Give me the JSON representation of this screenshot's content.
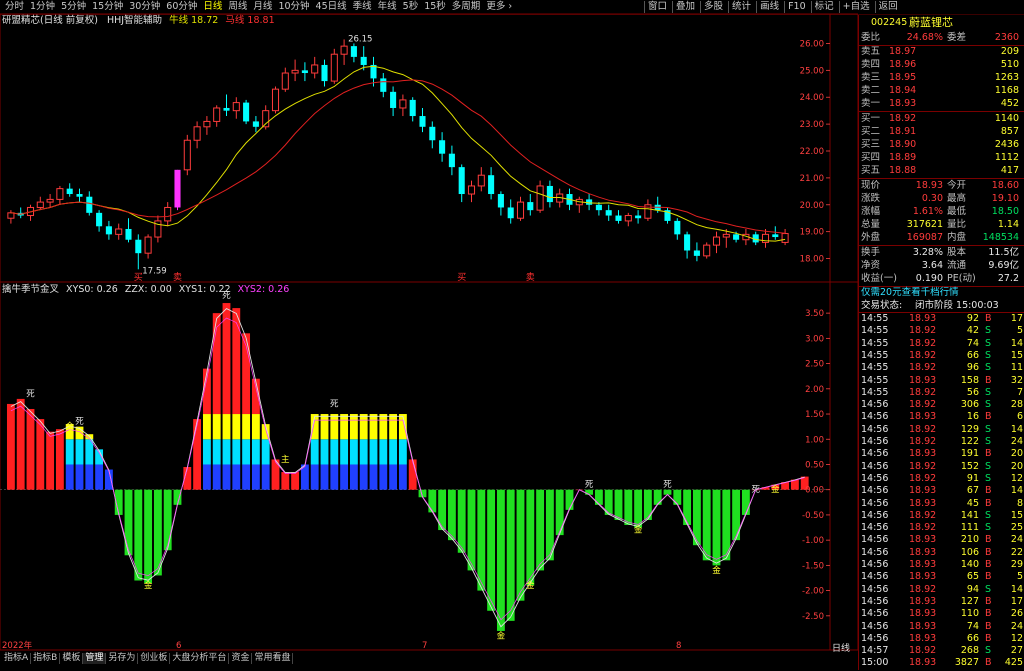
{
  "topbar": {
    "periods": [
      "分时",
      "1分钟",
      "5分钟",
      "15分钟",
      "30分钟",
      "60分钟",
      "日线",
      "周线",
      "月线",
      "10分钟",
      "45日线",
      "季线",
      "年线",
      "5秒",
      "15秒",
      "多周期",
      "更多 ›"
    ],
    "active_period": "日线",
    "tools": [
      "窗口",
      "叠加",
      "多股",
      "统计",
      "画线",
      "F10",
      "标记",
      "+自选",
      "返回"
    ]
  },
  "main_header": {
    "name": "研盟精芯(日线 前复权)",
    "indicator": "HHJ智能辅助",
    "bull_label": "牛线",
    "bull_value": "18.72",
    "horse_label": "马线",
    "horse_value": "18.81"
  },
  "sub_header": {
    "name": "擒牛季节金叉",
    "items": [
      "XYS0: 0.26",
      "ZZX: 0.00",
      "XYS1: 0.22",
      "XYS2: 0.26"
    ]
  },
  "price_axis": [
    "26.00",
    "25.00",
    "24.00",
    "23.00",
    "22.00",
    "21.00",
    "20.00",
    "19.00",
    "18.00"
  ],
  "sub_axis": [
    "3.50",
    "3.00",
    "2.50",
    "2.00",
    "1.50",
    "1.00",
    "0.50",
    "0.00",
    "-0.50",
    "-1.00",
    "-1.50",
    "-2.00",
    "-2.50"
  ],
  "annotations": {
    "high": "26.15",
    "low": "17.59",
    "buy": "买",
    "sell": "卖",
    "signal_death": "死",
    "signal_gold": "金",
    "signal_main": "主"
  },
  "date_labels": [
    "2022年",
    "6",
    "7",
    "8"
  ],
  "bottom_tabs": [
    "指标A",
    "指标B",
    "模板",
    "管理",
    "另存为",
    "创业板",
    "大盘分析平台",
    "资金",
    "常用看盘"
  ],
  "active_tab": "管理",
  "period_tab": "日线",
  "stock": {
    "code": "002245",
    "name": "蔚蓝锂芯"
  },
  "order_book": {
    "ratio_label": "委比",
    "ratio": "24.68%",
    "diff_label": "委差",
    "diff": "2360",
    "asks": [
      {
        "label": "卖五",
        "price": "18.97",
        "vol": "209"
      },
      {
        "label": "卖四",
        "price": "18.96",
        "vol": "510"
      },
      {
        "label": "卖三",
        "price": "18.95",
        "vol": "1263"
      },
      {
        "label": "卖二",
        "price": "18.94",
        "vol": "1168"
      },
      {
        "label": "卖一",
        "price": "18.93",
        "vol": "452"
      }
    ],
    "bids": [
      {
        "label": "买一",
        "price": "18.92",
        "vol": "1140"
      },
      {
        "label": "买二",
        "price": "18.91",
        "vol": "857"
      },
      {
        "label": "买三",
        "price": "18.90",
        "vol": "2436"
      },
      {
        "label": "买四",
        "price": "18.89",
        "vol": "1112"
      },
      {
        "label": "买五",
        "price": "18.88",
        "vol": "417"
      }
    ]
  },
  "quote": [
    {
      "l1": "现价",
      "v1": "18.93",
      "l2": "今开",
      "v2": "18.60",
      "c1": "red",
      "c2": "red"
    },
    {
      "l1": "涨跌",
      "v1": "0.30",
      "l2": "最高",
      "v2": "19.10",
      "c1": "red",
      "c2": "red"
    },
    {
      "l1": "涨幅",
      "v1": "1.61%",
      "l2": "最低",
      "v2": "18.50",
      "c1": "red",
      "c2": "green"
    },
    {
      "l1": "总量",
      "v1": "317621",
      "l2": "量比",
      "v2": "1.14",
      "c1": "yellow",
      "c2": "yellow"
    },
    {
      "l1": "外盘",
      "v1": "169087",
      "l2": "内盘",
      "v2": "148534",
      "c1": "red",
      "c2": "green"
    }
  ],
  "fundamentals": [
    {
      "l1": "换手",
      "v1": "3.28%",
      "l2": "股本",
      "v2": "11.5亿"
    },
    {
      "l1": "净资",
      "v1": "3.64",
      "l2": "流通",
      "v2": "9.69亿"
    },
    {
      "l1": "收益(一)",
      "v1": "0.190",
      "l2": "PE(动)",
      "v2": "27.2"
    }
  ],
  "promo": "仅需20元查看千档行情",
  "trade_status_label": "交易状态:",
  "trade_status": "闭市阶段 15:00:03",
  "ticks": [
    {
      "t": "14:55",
      "p": "18.93",
      "v": "92",
      "s": "B",
      "n": "17"
    },
    {
      "t": "14:55",
      "p": "18.92",
      "v": "42",
      "s": "S",
      "n": "5"
    },
    {
      "t": "14:55",
      "p": "18.92",
      "v": "74",
      "s": "S",
      "n": "14"
    },
    {
      "t": "14:55",
      "p": "18.92",
      "v": "66",
      "s": "S",
      "n": "15"
    },
    {
      "t": "14:55",
      "p": "18.92",
      "v": "96",
      "s": "S",
      "n": "11"
    },
    {
      "t": "14:55",
      "p": "18.93",
      "v": "158",
      "s": "B",
      "n": "32"
    },
    {
      "t": "14:55",
      "p": "18.92",
      "v": "56",
      "s": "S",
      "n": "7"
    },
    {
      "t": "14:56",
      "p": "18.92",
      "v": "306",
      "s": "S",
      "n": "28"
    },
    {
      "t": "14:56",
      "p": "18.93",
      "v": "16",
      "s": "B",
      "n": "6"
    },
    {
      "t": "14:56",
      "p": "18.92",
      "v": "129",
      "s": "S",
      "n": "14"
    },
    {
      "t": "14:56",
      "p": "18.92",
      "v": "122",
      "s": "S",
      "n": "24"
    },
    {
      "t": "14:56",
      "p": "18.93",
      "v": "191",
      "s": "B",
      "n": "20"
    },
    {
      "t": "14:56",
      "p": "18.92",
      "v": "152",
      "s": "S",
      "n": "20"
    },
    {
      "t": "14:56",
      "p": "18.92",
      "v": "91",
      "s": "S",
      "n": "12"
    },
    {
      "t": "14:56",
      "p": "18.93",
      "v": "67",
      "s": "B",
      "n": "14"
    },
    {
      "t": "14:56",
      "p": "18.93",
      "v": "45",
      "s": "B",
      "n": "8"
    },
    {
      "t": "14:56",
      "p": "18.92",
      "v": "141",
      "s": "S",
      "n": "15"
    },
    {
      "t": "14:56",
      "p": "18.92",
      "v": "111",
      "s": "S",
      "n": "25"
    },
    {
      "t": "14:56",
      "p": "18.93",
      "v": "210",
      "s": "B",
      "n": "24"
    },
    {
      "t": "14:56",
      "p": "18.93",
      "v": "106",
      "s": "B",
      "n": "22"
    },
    {
      "t": "14:56",
      "p": "18.93",
      "v": "140",
      "s": "B",
      "n": "29"
    },
    {
      "t": "14:56",
      "p": "18.93",
      "v": "65",
      "s": "B",
      "n": "5"
    },
    {
      "t": "14:56",
      "p": "18.92",
      "v": "94",
      "s": "S",
      "n": "14"
    },
    {
      "t": "14:56",
      "p": "18.93",
      "v": "127",
      "s": "B",
      "n": "17"
    },
    {
      "t": "14:56",
      "p": "18.93",
      "v": "110",
      "s": "B",
      "n": "26"
    },
    {
      "t": "14:56",
      "p": "18.93",
      "v": "74",
      "s": "B",
      "n": "24"
    },
    {
      "t": "14:56",
      "p": "18.93",
      "v": "66",
      "s": "B",
      "n": "12"
    },
    {
      "t": "14:57",
      "p": "18.92",
      "v": "268",
      "s": "S",
      "n": "27"
    },
    {
      "t": "15:00",
      "p": "18.93",
      "v": "3827",
      "s": "B",
      "n": "425"
    }
  ],
  "colors": {
    "up": "#ff3c3c",
    "down": "#00ffff",
    "magenta": "#ff33ff",
    "bull": "#e0e000",
    "horse": "#e02020",
    "grid": "#7a0000"
  },
  "chart_data": {
    "type": "candlestick",
    "ylim": [
      17.5,
      26.5
    ],
    "candles": [
      [
        19.5,
        19.8,
        19.3,
        19.7
      ],
      [
        19.7,
        19.9,
        19.5,
        19.6
      ],
      [
        19.6,
        20.0,
        19.4,
        19.9
      ],
      [
        19.9,
        20.3,
        19.8,
        20.1
      ],
      [
        20.1,
        20.4,
        19.9,
        20.2
      ],
      [
        20.2,
        20.7,
        20.0,
        20.6
      ],
      [
        20.6,
        20.8,
        20.3,
        20.4
      ],
      [
        20.4,
        20.6,
        20.1,
        20.3
      ],
      [
        20.3,
        20.5,
        19.6,
        19.7
      ],
      [
        19.7,
        19.8,
        19.0,
        19.2
      ],
      [
        19.2,
        19.4,
        18.7,
        18.9
      ],
      [
        18.9,
        19.3,
        18.7,
        19.1
      ],
      [
        19.1,
        19.5,
        18.6,
        18.7
      ],
      [
        18.7,
        18.9,
        17.6,
        18.2
      ],
      [
        18.2,
        18.9,
        18.0,
        18.8
      ],
      [
        18.8,
        19.6,
        18.6,
        19.4
      ],
      [
        19.4,
        20.1,
        19.2,
        19.9
      ],
      [
        19.9,
        21.3,
        19.8,
        21.3
      ],
      [
        21.3,
        22.6,
        21.1,
        22.4
      ],
      [
        22.4,
        23.1,
        22.1,
        22.9
      ],
      [
        22.9,
        23.3,
        22.6,
        23.1
      ],
      [
        23.1,
        23.7,
        22.9,
        23.6
      ],
      [
        23.6,
        24.1,
        23.3,
        23.5
      ],
      [
        23.5,
        24.0,
        23.2,
        23.8
      ],
      [
        23.8,
        23.9,
        23.0,
        23.1
      ],
      [
        23.1,
        23.3,
        22.7,
        22.9
      ],
      [
        22.9,
        23.7,
        22.8,
        23.5
      ],
      [
        23.5,
        24.4,
        23.4,
        24.3
      ],
      [
        24.3,
        25.1,
        24.2,
        24.9
      ],
      [
        24.9,
        25.4,
        24.6,
        25.0
      ],
      [
        25.0,
        25.3,
        24.6,
        24.9
      ],
      [
        24.9,
        25.5,
        24.7,
        25.2
      ],
      [
        25.2,
        25.4,
        24.4,
        24.6
      ],
      [
        24.6,
        25.8,
        24.5,
        25.6
      ],
      [
        25.6,
        26.15,
        25.2,
        25.9
      ],
      [
        25.9,
        26.0,
        25.3,
        25.5
      ],
      [
        25.5,
        25.9,
        25.0,
        25.2
      ],
      [
        25.2,
        25.5,
        24.4,
        24.7
      ],
      [
        24.7,
        24.9,
        24.0,
        24.2
      ],
      [
        24.2,
        24.4,
        23.3,
        23.6
      ],
      [
        23.6,
        24.1,
        23.3,
        23.9
      ],
      [
        23.9,
        24.0,
        23.1,
        23.3
      ],
      [
        23.3,
        23.6,
        22.7,
        22.9
      ],
      [
        22.9,
        23.1,
        22.1,
        22.4
      ],
      [
        22.4,
        22.7,
        21.6,
        21.9
      ],
      [
        21.9,
        22.2,
        21.1,
        21.4
      ],
      [
        21.4,
        21.5,
        20.1,
        20.4
      ],
      [
        20.4,
        20.9,
        20.1,
        20.7
      ],
      [
        20.7,
        21.4,
        20.5,
        21.1
      ],
      [
        21.1,
        21.4,
        20.2,
        20.4
      ],
      [
        20.4,
        20.5,
        19.6,
        19.9
      ],
      [
        19.9,
        20.2,
        19.3,
        19.5
      ],
      [
        19.5,
        20.3,
        19.4,
        20.1
      ],
      [
        20.1,
        20.4,
        19.6,
        19.8
      ],
      [
        19.8,
        20.9,
        19.7,
        20.7
      ],
      [
        20.7,
        20.9,
        19.9,
        20.1
      ],
      [
        20.1,
        20.6,
        19.9,
        20.4
      ],
      [
        20.4,
        20.6,
        19.8,
        20.0
      ],
      [
        20.0,
        20.3,
        19.7,
        20.2
      ],
      [
        20.2,
        20.4,
        19.8,
        20.0
      ],
      [
        20.0,
        20.1,
        19.6,
        19.8
      ],
      [
        19.8,
        20.0,
        19.4,
        19.6
      ],
      [
        19.6,
        19.8,
        19.3,
        19.4
      ],
      [
        19.4,
        19.7,
        19.2,
        19.6
      ],
      [
        19.6,
        19.8,
        19.3,
        19.5
      ],
      [
        19.5,
        20.2,
        19.4,
        20.0
      ],
      [
        20.0,
        20.3,
        19.7,
        19.8
      ],
      [
        19.8,
        19.9,
        19.3,
        19.4
      ],
      [
        19.4,
        19.5,
        18.7,
        18.9
      ],
      [
        18.9,
        19.0,
        18.0,
        18.3
      ],
      [
        18.3,
        18.6,
        17.9,
        18.1
      ],
      [
        18.1,
        18.6,
        18.0,
        18.5
      ],
      [
        18.5,
        19.0,
        18.2,
        18.8
      ],
      [
        18.8,
        19.1,
        18.4,
        18.9
      ],
      [
        18.9,
        19.0,
        18.6,
        18.7
      ],
      [
        18.7,
        19.1,
        18.5,
        18.9
      ],
      [
        18.9,
        19.0,
        18.5,
        18.6
      ],
      [
        18.6,
        19.1,
        18.4,
        18.9
      ],
      [
        18.9,
        19.2,
        18.7,
        18.8
      ],
      [
        18.6,
        19.1,
        18.5,
        18.93
      ]
    ],
    "magenta_index": 17,
    "sub_ylim": [
      -2.9,
      3.8
    ],
    "sub_values": [
      1.7,
      1.8,
      1.6,
      1.4,
      1.15,
      1.2,
      1.3,
      1.25,
      1.1,
      0.8,
      0.4,
      -0.5,
      -1.3,
      -1.8,
      -1.85,
      -1.7,
      -1.2,
      -0.3,
      0.45,
      1.4,
      2.4,
      3.5,
      3.7,
      3.6,
      3.1,
      2.2,
      1.3,
      0.6,
      0.35,
      0.35,
      0.5,
      1.5,
      1.5,
      1.5,
      1.5,
      1.5,
      1.5,
      1.5,
      1.5,
      1.5,
      1.5,
      0.6,
      -0.15,
      -0.45,
      -0.8,
      -1.0,
      -1.25,
      -1.6,
      -2.0,
      -2.4,
      -2.8,
      -2.6,
      -2.2,
      -1.9,
      -1.6,
      -1.4,
      -0.9,
      -0.4,
      0.0,
      -0.1,
      -0.3,
      -0.5,
      -0.6,
      -0.7,
      -0.75,
      -0.6,
      -0.3,
      -0.1,
      -0.3,
      -0.7,
      -1.1,
      -1.4,
      -1.5,
      -1.4,
      -1.0,
      -0.5,
      0.0,
      0.05,
      0.1,
      0.15,
      0.2,
      0.26
    ],
    "bull_line": [],
    "horse_line": []
  }
}
